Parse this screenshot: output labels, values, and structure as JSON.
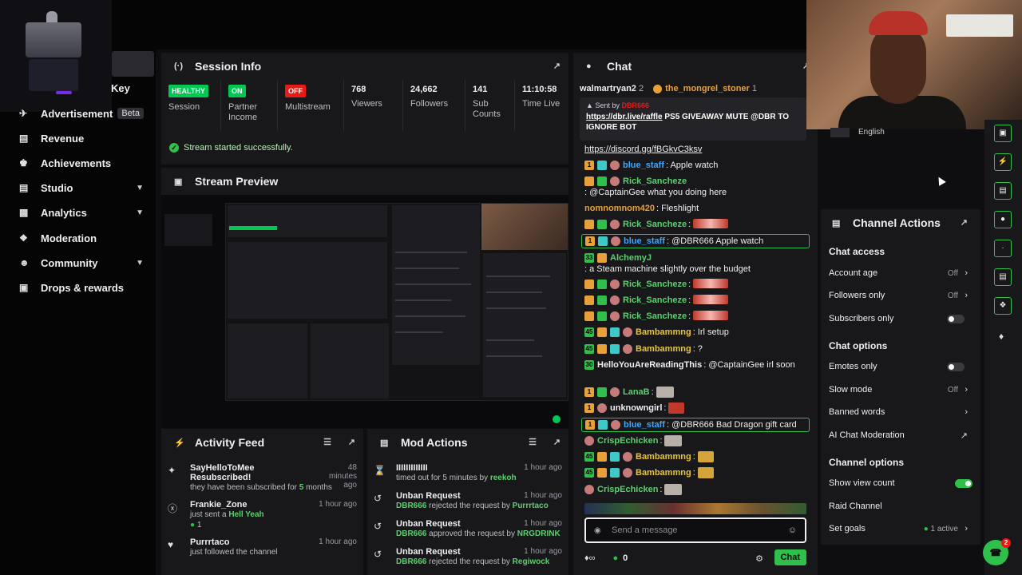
{
  "sidebar": {
    "key_label": "Key",
    "items": [
      {
        "label": "Advertisement",
        "icon": "megaphone-icon",
        "badge": "Beta"
      },
      {
        "label": "Revenue",
        "icon": "dollar-icon"
      },
      {
        "label": "Achievements",
        "icon": "trophy-icon"
      },
      {
        "label": "Studio",
        "icon": "studio-icon",
        "expandable": true
      },
      {
        "label": "Analytics",
        "icon": "chart-icon",
        "expandable": true
      },
      {
        "label": "Moderation",
        "icon": "wrench-icon"
      },
      {
        "label": "Community",
        "icon": "people-icon",
        "expandable": true
      },
      {
        "label": "Drops & rewards",
        "icon": "gift-icon"
      }
    ]
  },
  "session": {
    "title": "Session Info",
    "stats": [
      {
        "badge": "HEALTHY",
        "badge_color": "#00c853",
        "label": "Session"
      },
      {
        "badge": "ON",
        "badge_color": "#00c853",
        "label": "Partner Income"
      },
      {
        "badge": "OFF",
        "badge_color": "#e91916",
        "label": "Multistream"
      },
      {
        "value": "768",
        "label": "Viewers"
      },
      {
        "value": "24,662",
        "label": "Followers"
      },
      {
        "value": "141",
        "label": "Sub Counts"
      },
      {
        "value": "11:10:58",
        "label": "Time Live"
      }
    ],
    "status": "Stream started successfully."
  },
  "preview": {
    "title": "Stream Preview"
  },
  "activity": {
    "title": "Activity Feed",
    "items": [
      {
        "name": "SayHelloToMee Resubscribed!",
        "desc_pre": "they have been subscribed for ",
        "desc_hl": "5",
        "desc_post": " months",
        "time": "48 minutes ago"
      },
      {
        "name": "Frankie_Zone",
        "desc_pre": "just sent a ",
        "desc_hl": "Hell Yeah",
        "desc_post": "",
        "count": "1",
        "time": "1 hour ago"
      },
      {
        "name": "Purrrtaco",
        "desc_pre": "just followed the channel",
        "desc_hl": "",
        "desc_post": "",
        "time": "1 hour ago"
      }
    ]
  },
  "mod": {
    "title": "Mod Actions",
    "items": [
      {
        "name": "IIIIIIIIIIIII",
        "desc_pre": "timed out for 5 minutes by ",
        "actor": "reekoh",
        "target": "",
        "time": "1 hour ago"
      },
      {
        "name": "Unban Request",
        "target": "DBR666",
        "desc_pre": " rejected the request by ",
        "actor": "Purrrtaco",
        "time": "1 hour ago"
      },
      {
        "name": "Unban Request",
        "target": "DBR666",
        "desc_pre": " approved the request by ",
        "actor": "NRGDRINK",
        "time": "1 hour ago"
      },
      {
        "name": "Unban Request",
        "target": "DBR666",
        "desc_pre": " rejected the request by ",
        "actor": "Regiwock",
        "time": "1 hour ago"
      }
    ]
  },
  "chat": {
    "title": "Chat",
    "top_user1": "walmartryan2",
    "top_count1": "2",
    "top_user2": "the_mongrel_stoner",
    "top_count2": "1",
    "pinned": {
      "sent_by": "Sent by",
      "sender": "DBR666",
      "link": "https://dbr.live/raffle",
      "message": " PS5 GIVEAWAY MUTE @DBR TO IGNORE BOT"
    },
    "discord": "https://discord.gg/fBGkvC3ksv",
    "messages": [
      {
        "user": "blue_staff",
        "color": "#3ea6ff",
        "text": ": Apple watch"
      },
      {
        "user": "Rick_Sancheze",
        "color": "#5ad16e",
        "text": ": @CaptainGee what you doing here"
      },
      {
        "user": "nomnomnom420",
        "color": "#e8a13a",
        "text": ": Fleshlight"
      },
      {
        "user": "Rick_Sancheze",
        "color": "#5ad16e",
        "text": ":"
      },
      {
        "user": "blue_staff",
        "color": "#3ea6ff",
        "text": ": @DBR666 Apple watch"
      },
      {
        "user": "AlchemyJ",
        "color": "#5ad16e",
        "text": ": a Steam machine slightly over the budget"
      },
      {
        "user": "Rick_Sancheze",
        "color": "#5ad16e",
        "text": ":"
      },
      {
        "user": "Rick_Sancheze",
        "color": "#5ad16e",
        "text": ":"
      },
      {
        "user": "Rick_Sancheze",
        "color": "#5ad16e",
        "text": ":"
      },
      {
        "user": "Bambammng",
        "color": "#e8c43a",
        "text": ": Irl setup"
      },
      {
        "user": "Bambammng",
        "color": "#e8c43a",
        "text": ": ?"
      },
      {
        "user": "HelloYouAreReadingThis",
        "color": "#efeff1",
        "text": ": @CaptainGee irl soon"
      },
      {
        "user": "LanaB",
        "color": "#5ad16e",
        "text": ":"
      },
      {
        "user": "unknowngirl",
        "color": "#efeff1",
        "text": ":"
      },
      {
        "user": "blue_staff",
        "color": "#3ea6ff",
        "text": ": @DBR666 Bad Dragon gift card"
      },
      {
        "user": "CrispEchicken",
        "color": "#5ad16e",
        "text": ":"
      },
      {
        "user": "Bambammng",
        "color": "#e8c43a",
        "text": ":"
      },
      {
        "user": "Bambammng",
        "color": "#e8c43a",
        "text": ":"
      },
      {
        "user": "CrispEchicken",
        "color": "#5ad16e",
        "text": ":"
      }
    ],
    "input_placeholder": "Send a message",
    "points": "0",
    "send_label": "Chat"
  },
  "channel_actions": {
    "title": "Channel Actions",
    "language": "English",
    "chat_access": "Chat access",
    "account_age": "Account age",
    "account_age_val": "Off",
    "followers_only": "Followers only",
    "followers_only_val": "Off",
    "subscribers_only": "Subscribers only",
    "chat_options": "Chat options",
    "emotes_only": "Emotes only",
    "slow_mode": "Slow mode",
    "slow_mode_val": "Off",
    "banned_words": "Banned words",
    "ai_mod": "AI Chat Moderation",
    "channel_options": "Channel options",
    "show_view_count": "Show view count",
    "raid_channel": "Raid Channel",
    "set_goals": "Set goals",
    "set_goals_val": "1 active"
  },
  "help": {
    "count": "2"
  },
  "colors": {
    "accent": "#2fbf4a",
    "danger": "#e91916",
    "bg": "#0e0e10",
    "panel": "#18181b"
  }
}
